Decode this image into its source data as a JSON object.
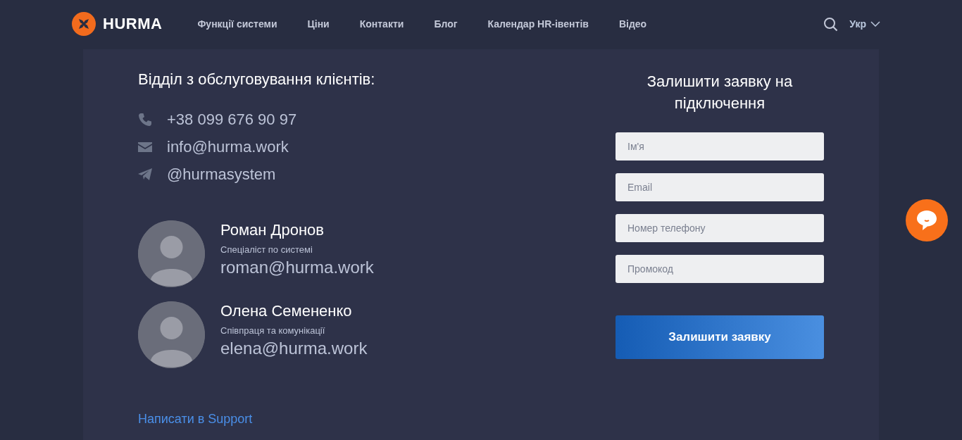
{
  "header": {
    "logo": "HURMA",
    "nav": [
      {
        "label": "Функції системи"
      },
      {
        "label": "Ціни"
      },
      {
        "label": "Контакти"
      },
      {
        "label": "Блог"
      },
      {
        "label": "Календар HR-івентів"
      },
      {
        "label": "Відео"
      }
    ],
    "language": "Укр"
  },
  "contacts": {
    "heading": "Відділ з обслуговування клієнтів:",
    "channels": [
      {
        "kind": "phone",
        "text": "+38 099 676 90 97"
      },
      {
        "kind": "email",
        "text": "info@hurma.work"
      },
      {
        "kind": "telegram",
        "text": "@hurmasystem"
      }
    ],
    "people": [
      {
        "name": "Роман Дронов",
        "role": "Спеціаліст по системі",
        "email": "roman@hurma.work"
      },
      {
        "name": "Олена Семененко",
        "role": "Співпраця та комунікації",
        "email": "elena@hurma.work"
      }
    ],
    "support_link": "Написати в Support"
  },
  "form": {
    "title": "Залишити заявку на підключення",
    "fields": [
      {
        "placeholder": "Ім'я"
      },
      {
        "placeholder": "Email"
      },
      {
        "placeholder": "Номер телефону"
      },
      {
        "placeholder": "Промокод"
      }
    ],
    "submit": "Залишити заявку"
  }
}
